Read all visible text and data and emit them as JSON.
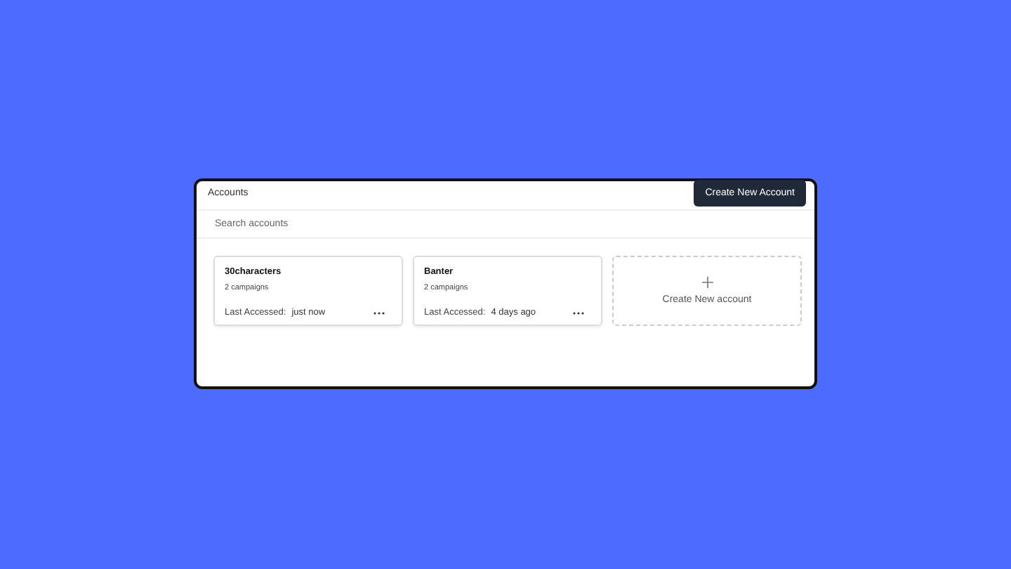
{
  "header": {
    "title": "Accounts",
    "button": "Create New Account"
  },
  "search": {
    "placeholder": "Search accounts"
  },
  "accounts": [
    {
      "name": "30characters",
      "campaigns": "2 campaigns",
      "last_label": "Last Accessed:",
      "last_value": "just now"
    },
    {
      "name": "Banter",
      "campaigns": "2 campaigns",
      "last_label": "Last Accessed:",
      "last_value": "4 days ago"
    }
  ],
  "new_card": {
    "label": "Create New account"
  }
}
